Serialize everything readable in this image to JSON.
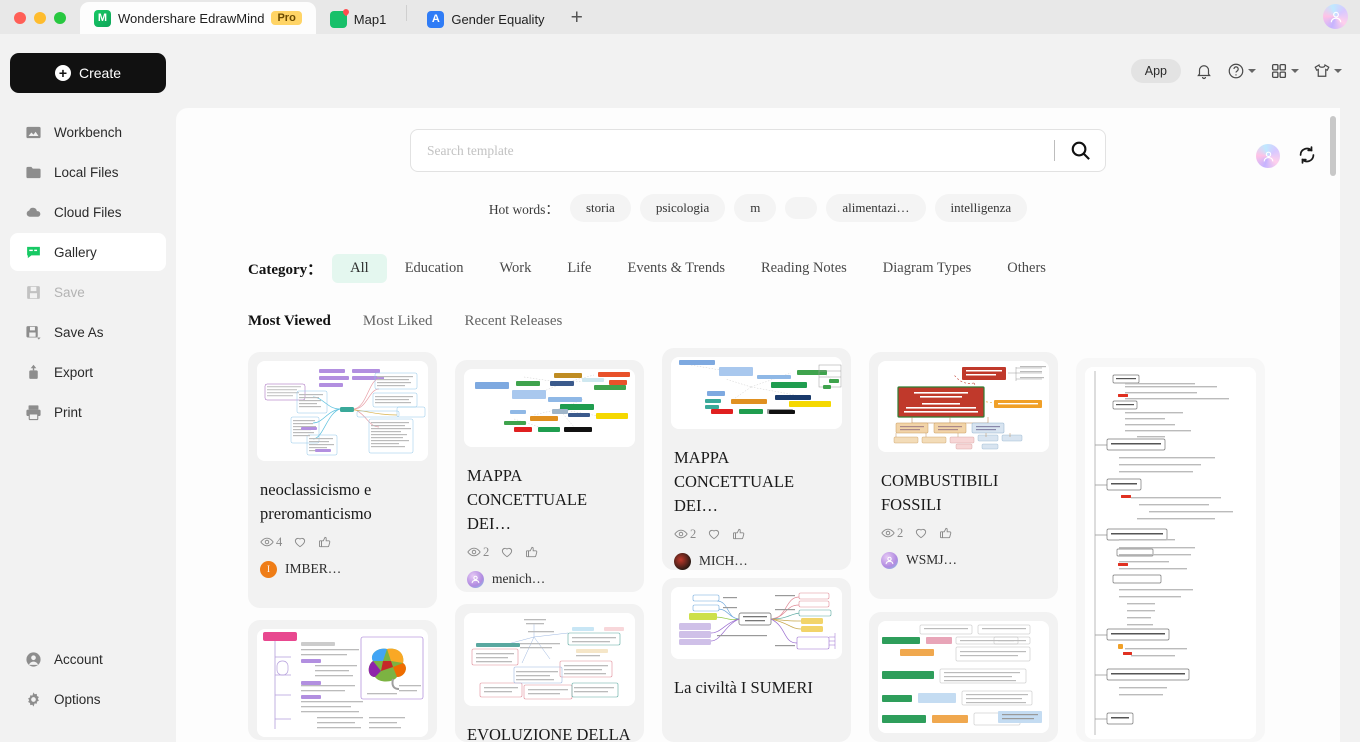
{
  "titlebar": {
    "tabs": [
      {
        "label": "Wondershare EdrawMind",
        "badge": "Pro",
        "icon": "edrawmind-icon",
        "active": true
      },
      {
        "label": "Map1",
        "badge": "",
        "icon": "map-icon",
        "active": false
      },
      {
        "label": "Gender Equality",
        "badge": "",
        "icon": "document-icon",
        "active": false
      }
    ],
    "new_tab_label": "+"
  },
  "sidebar": {
    "create_label": "Create",
    "items": [
      {
        "label": "Workbench",
        "icon": "workbench-icon",
        "state": "normal"
      },
      {
        "label": "Local Files",
        "icon": "folder-icon",
        "state": "normal"
      },
      {
        "label": "Cloud Files",
        "icon": "cloud-icon",
        "state": "normal"
      },
      {
        "label": "Gallery",
        "icon": "gallery-icon",
        "state": "active"
      },
      {
        "label": "Save",
        "icon": "save-icon",
        "state": "disabled"
      },
      {
        "label": "Save As",
        "icon": "save-as-icon",
        "state": "normal"
      },
      {
        "label": "Export",
        "icon": "export-icon",
        "state": "normal"
      },
      {
        "label": "Print",
        "icon": "print-icon",
        "state": "normal"
      }
    ],
    "bottom_items": [
      {
        "label": "Account",
        "icon": "account-icon"
      },
      {
        "label": "Options",
        "icon": "gear-icon"
      }
    ]
  },
  "topbar": {
    "app_chip": "App",
    "icons": [
      "bell-icon",
      "help-icon",
      "apps-grid-icon",
      "theme-shirt-icon"
    ]
  },
  "search": {
    "placeholder": "Search template",
    "value": "",
    "button_icon": "search-icon"
  },
  "hotwords": {
    "label": "Hot words：",
    "items": [
      "storia",
      "psicologia",
      "m",
      "",
      "alimentazi…",
      "intelligenza"
    ]
  },
  "category": {
    "label": "Category：",
    "items": [
      "All",
      "Education",
      "Work",
      "Life",
      "Events & Trends",
      "Reading Notes",
      "Diagram Types",
      "Others"
    ],
    "selected": "All"
  },
  "sort": {
    "items": [
      "Most Viewed",
      "Most Liked",
      "Recent Releases"
    ],
    "selected": "Most Viewed"
  },
  "cards": [
    {
      "title": "neoclassicismo e preromanticismo",
      "views": "4",
      "author": "IMBER…",
      "avatar_color": "#ef7d17",
      "avatar_letter": "I",
      "thumb_style": "mindmap-purple"
    },
    {
      "title": "MAPPA CONCETTUALE DEI…",
      "views": "2",
      "author": "menich…",
      "avatar_color": "#d9a8ee",
      "avatar_letter": "",
      "thumb_style": "mindmap-colorful"
    },
    {
      "title": "MAPPA CONCETTUALE DEI…",
      "views": "2",
      "author": "MICH…",
      "avatar_color": "#3b2a22",
      "avatar_letter": "",
      "thumb_style": "mindmap-colorful2"
    },
    {
      "title": "COMBUSTIBILI FOSSILI",
      "views": "2",
      "author": "WSMJ…",
      "avatar_color": "#d9a8ee",
      "avatar_letter": "",
      "thumb_style": "diagram-red"
    },
    {
      "title": "",
      "views": "",
      "author": "",
      "avatar_color": "",
      "avatar_letter": "",
      "thumb_style": "outline-tall"
    },
    {
      "title": "",
      "views": "",
      "author": "",
      "avatar_color": "",
      "avatar_letter": "",
      "thumb_style": "brain-map"
    },
    {
      "title": "EVOLUZIONE DELLA",
      "views": "",
      "author": "",
      "avatar_color": "",
      "avatar_letter": "",
      "thumb_style": "mindmap-pink"
    },
    {
      "title": "La civiltà I SUMERI",
      "views": "",
      "author": "",
      "avatar_color": "",
      "avatar_letter": "",
      "thumb_style": "mindmap-sumeri"
    },
    {
      "title": "",
      "views": "",
      "author": "",
      "avatar_color": "",
      "avatar_letter": "",
      "thumb_style": "mindmap-green"
    }
  ],
  "colors": {
    "accent_green": "#17c964",
    "category_active_bg": "#e4f7ef",
    "pro_badge": "#ffd466",
    "panel_bg": "#fdfdfd",
    "app_bg": "#f2f2f2"
  }
}
